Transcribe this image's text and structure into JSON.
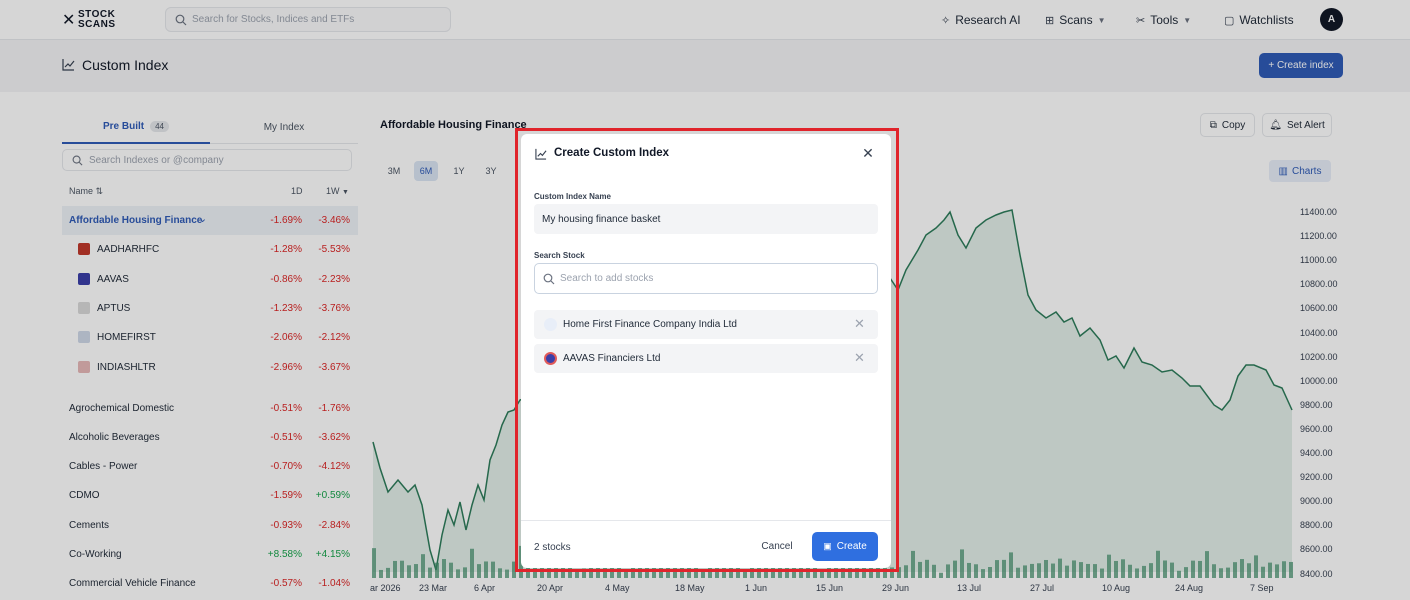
{
  "nav": {
    "logo_line1": "STOCK",
    "logo_line2": "SCANS",
    "search_placeholder": "Search for Stocks, Indices and ETFs",
    "research_ai": "Research AI",
    "scans": "Scans",
    "tools": "Tools",
    "watchlists": "Watchlists",
    "avatar_initial": "A"
  },
  "page": {
    "title": "Custom Index",
    "create_button": "+ Create index"
  },
  "left_panel": {
    "tabs": [
      {
        "label": "Pre Built",
        "count": "44",
        "active": true
      },
      {
        "label": "My Index",
        "active": false
      }
    ],
    "search_placeholder": "Search Indexes or @company",
    "columns": {
      "name": "Name",
      "d1": "1D",
      "w1": "1W"
    },
    "rows": [
      {
        "name": "Affordable Housing Finance",
        "d1": "-1.69%",
        "w1": "-3.46%",
        "selected": true
      },
      {
        "name": "AADHARHFC",
        "d1": "-1.28%",
        "w1": "-5.53%",
        "sub": true,
        "logo_color": "#c0392b"
      },
      {
        "name": "AAVAS",
        "d1": "-0.86%",
        "w1": "-2.23%",
        "sub": true,
        "logo_color": "#3b3fa8"
      },
      {
        "name": "APTUS",
        "d1": "-1.23%",
        "w1": "-3.76%",
        "sub": true,
        "logo_color": "#d9d9d9"
      },
      {
        "name": "HOMEFIRST",
        "d1": "-2.06%",
        "w1": "-2.12%",
        "sub": true,
        "logo_color": "#cfd8e8"
      },
      {
        "name": "INDIASHLTR",
        "d1": "-2.96%",
        "w1": "-3.67%",
        "sub": true,
        "logo_color": "#e6b8b8"
      },
      {
        "name": "Agrochemical Domestic",
        "d1": "-0.51%",
        "w1": "-1.76%"
      },
      {
        "name": "Alcoholic Beverages",
        "d1": "-0.51%",
        "w1": "-3.62%"
      },
      {
        "name": "Cables - Power",
        "d1": "-0.70%",
        "w1": "-4.12%"
      },
      {
        "name": "CDMO",
        "d1": "-1.59%",
        "w1": "+0.59%"
      },
      {
        "name": "Cements",
        "d1": "-0.93%",
        "w1": "-2.84%"
      },
      {
        "name": "Co-Working",
        "d1": "+8.58%",
        "w1": "+4.15%"
      },
      {
        "name": "Commercial Vehicle Finance",
        "d1": "-0.57%",
        "w1": "-1.04%"
      }
    ]
  },
  "chart_panel": {
    "title": "Affordable Housing Finance",
    "copy": "Copy",
    "set_alert": "Set Alert",
    "charts": "Charts",
    "ranges": [
      "3M",
      "6M",
      "1Y",
      "3Y"
    ],
    "active_range": "6M",
    "y_ticks": [
      "11400.00",
      "11200.00",
      "11000.00",
      "10800.00",
      "10600.00",
      "10400.00",
      "10200.00",
      "10000.00",
      "9800.00",
      "9600.00",
      "9400.00",
      "9200.00",
      "9000.00",
      "8800.00",
      "8600.00",
      "8400.00"
    ],
    "x_ticks": [
      "ar 2026",
      "23 Mar",
      "6 Apr",
      "20 Apr",
      "4 May",
      "18 May",
      "1 Jun",
      "15 Jun",
      "29 Jun",
      "13 Jul",
      "27 Jul",
      "10 Aug",
      "24 Aug",
      "7 Sep"
    ],
    "colors": {
      "line": "#2e7d5b",
      "fill": "#e3efe9",
      "volume": "#3f8f6a"
    }
  },
  "modal": {
    "title": "Create Custom Index",
    "name_label": "Custom Index Name",
    "name_value": "My housing finance basket",
    "search_label": "Search Stock",
    "search_placeholder": "Search to add stocks",
    "stocks": [
      {
        "name": "Home First Finance Company India Ltd",
        "logo_color": "#cfd8e8"
      },
      {
        "name": "AAVAS Financiers Ltd",
        "logo_color": "#3b3fa8"
      }
    ],
    "count_text": "2 stocks",
    "cancel": "Cancel",
    "create": "Create",
    "highlight_color": "#e0242b"
  }
}
